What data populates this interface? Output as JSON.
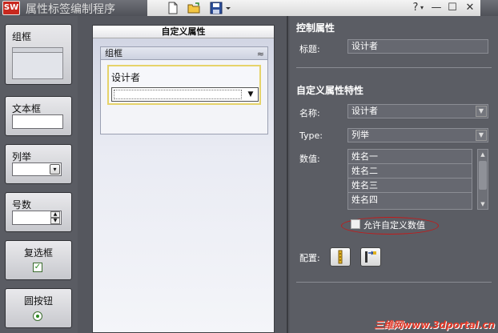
{
  "window": {
    "logo_text": "SW",
    "title": "属性标签编制程序",
    "help_label": "?",
    "minimize_label": "—",
    "maximize_label": "☐",
    "close_label": "✕"
  },
  "palette": {
    "items": [
      {
        "label": "组框"
      },
      {
        "label": "文本框"
      },
      {
        "label": "列举"
      },
      {
        "label": "号数"
      },
      {
        "label": "复选框"
      },
      {
        "label": "圆按钮"
      }
    ]
  },
  "canvas": {
    "title": "自定义属性",
    "group_title": "组框",
    "field_label": "设计者"
  },
  "props": {
    "control_section_title": "控制属性",
    "caption_label": "标题:",
    "caption_value": "设计者",
    "custom_section_title": "自定义属性特性",
    "name_label": "名称:",
    "name_value": "设计者",
    "type_label": "Type:",
    "type_value": "列举",
    "values_label": "数值:",
    "values": [
      "姓名一",
      "姓名二",
      "姓名三",
      "姓名四"
    ],
    "allow_custom_label": "允许自定义数值",
    "config_label": "配置:"
  },
  "watermark": "三维网www.3dportal.cn",
  "colors": {
    "accent_red": "#c21a1a",
    "highlight_yellow": "#e6d36a",
    "check_green": "#2b8a1f"
  }
}
